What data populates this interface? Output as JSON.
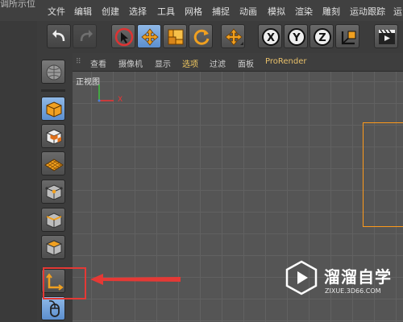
{
  "window": {
    "title_fragment": "调所示位"
  },
  "menu": [
    "文件",
    "编辑",
    "创建",
    "选择",
    "工具",
    "网格",
    "捕捉",
    "动画",
    "模拟",
    "渲染",
    "雕刻",
    "运动跟踪",
    "运"
  ],
  "viewport_menu": {
    "items": [
      "查看",
      "摄像机",
      "显示",
      "选项",
      "过滤",
      "面板"
    ],
    "plugin": "ProRender"
  },
  "viewport": {
    "label": "正视图",
    "axis_x_label": "X"
  },
  "toolbar_icons": [
    "undo-icon",
    "redo-icon",
    "live-select-icon",
    "move-icon",
    "scale-icon",
    "rotate-icon",
    "recent-tools-icon",
    "x-axis-icon",
    "y-axis-icon",
    "z-axis-icon",
    "coordinate-system-icon",
    "render-view-icon"
  ],
  "palette_icons": [
    "display-mode-icon",
    "model-mode-icon",
    "texture-mode-icon",
    "workplane-mode-icon",
    "points-mode-icon",
    "edges-mode-icon",
    "polygons-mode-icon",
    "axis-mode-icon",
    "tweak-mode-icon"
  ],
  "watermark": {
    "title": "溜溜自学",
    "url": "ZIXUE.3D66.COM"
  },
  "colors": {
    "accent_orange": "#f0a020",
    "active_blue": "#6e9fd8",
    "highlight_red": "#e53935",
    "plugin_text": "#e8c06a"
  }
}
